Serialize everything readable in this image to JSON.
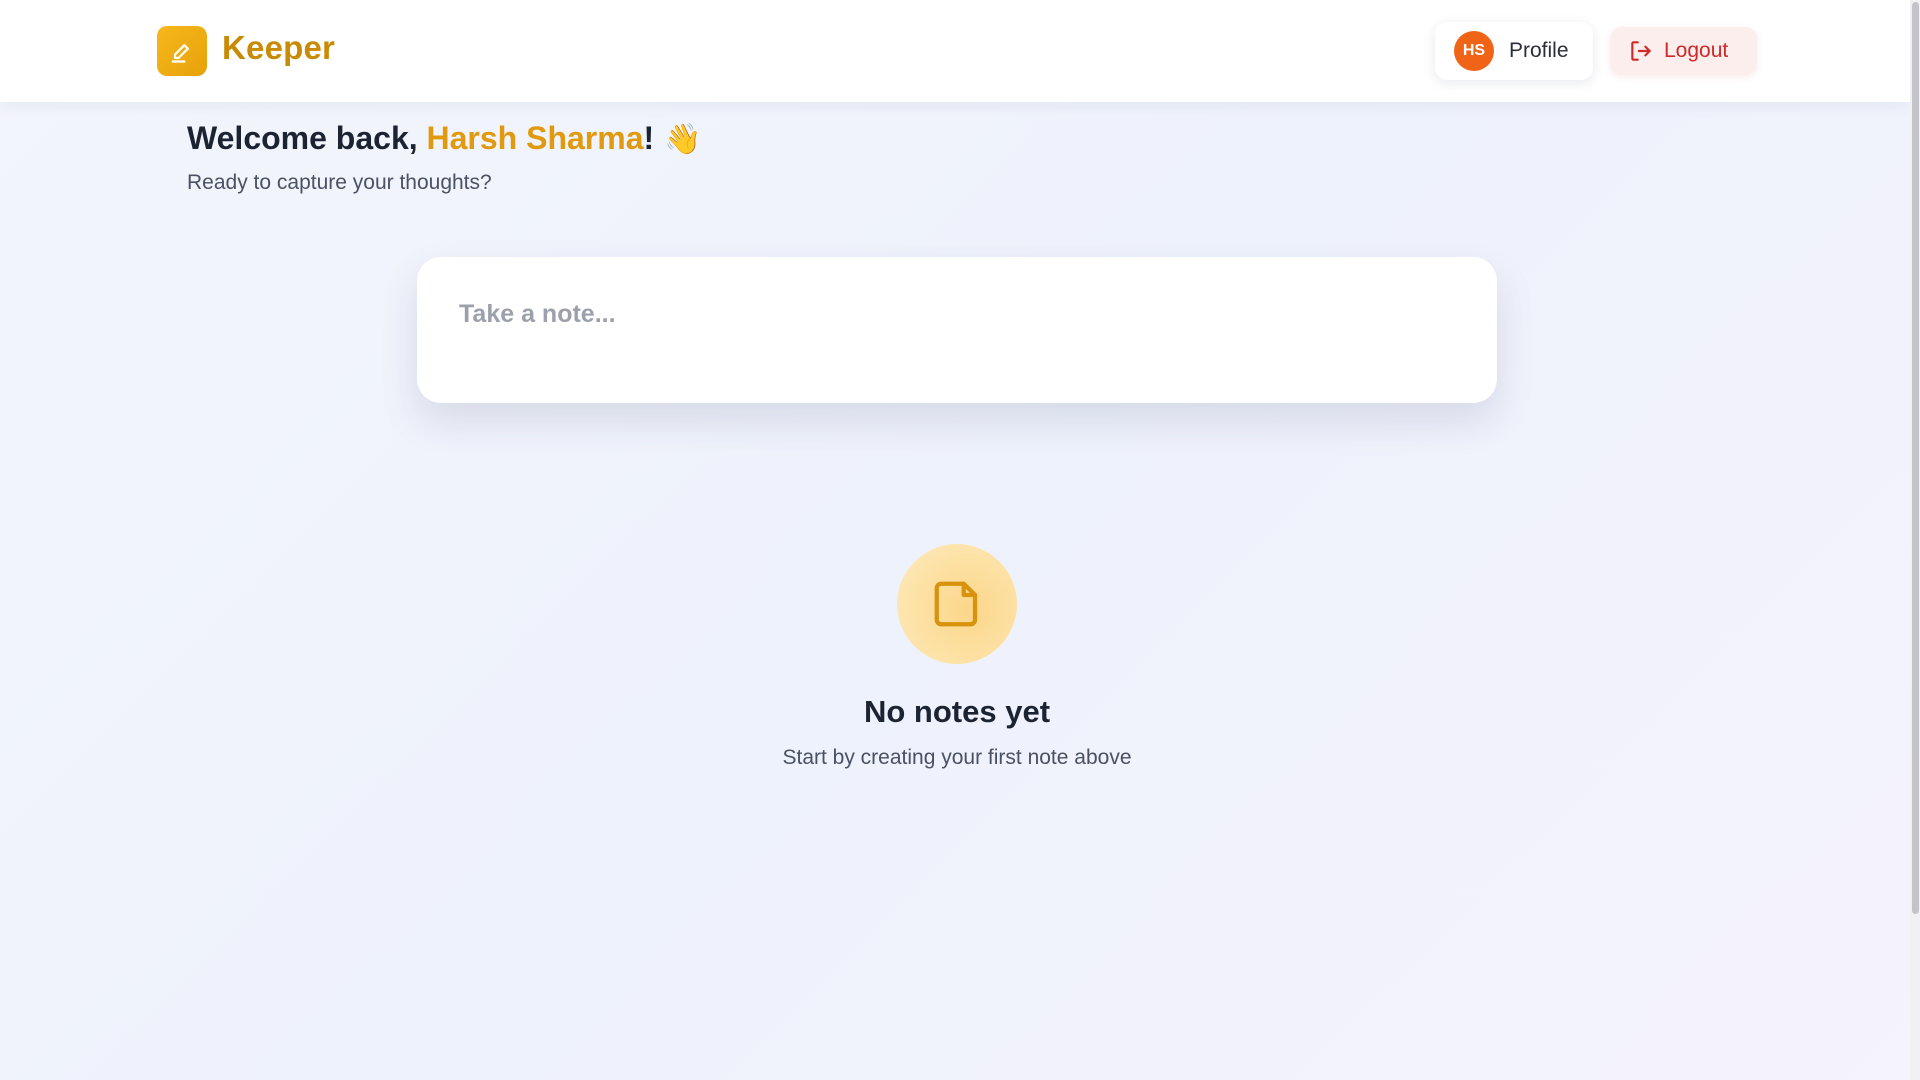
{
  "app": {
    "name": "Keeper",
    "brand_color": "#e8a10a"
  },
  "header": {
    "logo_icon": "pen-icon",
    "profile": {
      "initials": "HS",
      "label": "Profile",
      "avatar_color": "#f06418"
    },
    "logout": {
      "label": "Logout",
      "icon": "logout-icon",
      "color": "#d02929"
    }
  },
  "welcome": {
    "prefix": "Welcome back, ",
    "user_name": "Harsh Sharma",
    "suffix": "!",
    "emoji": "👋",
    "subtitle": "Ready to capture your thoughts?"
  },
  "note_input": {
    "placeholder": "Take a note..."
  },
  "empty_state": {
    "icon": "note-icon",
    "title": "No notes yet",
    "message": "Start by creating your first note above"
  }
}
